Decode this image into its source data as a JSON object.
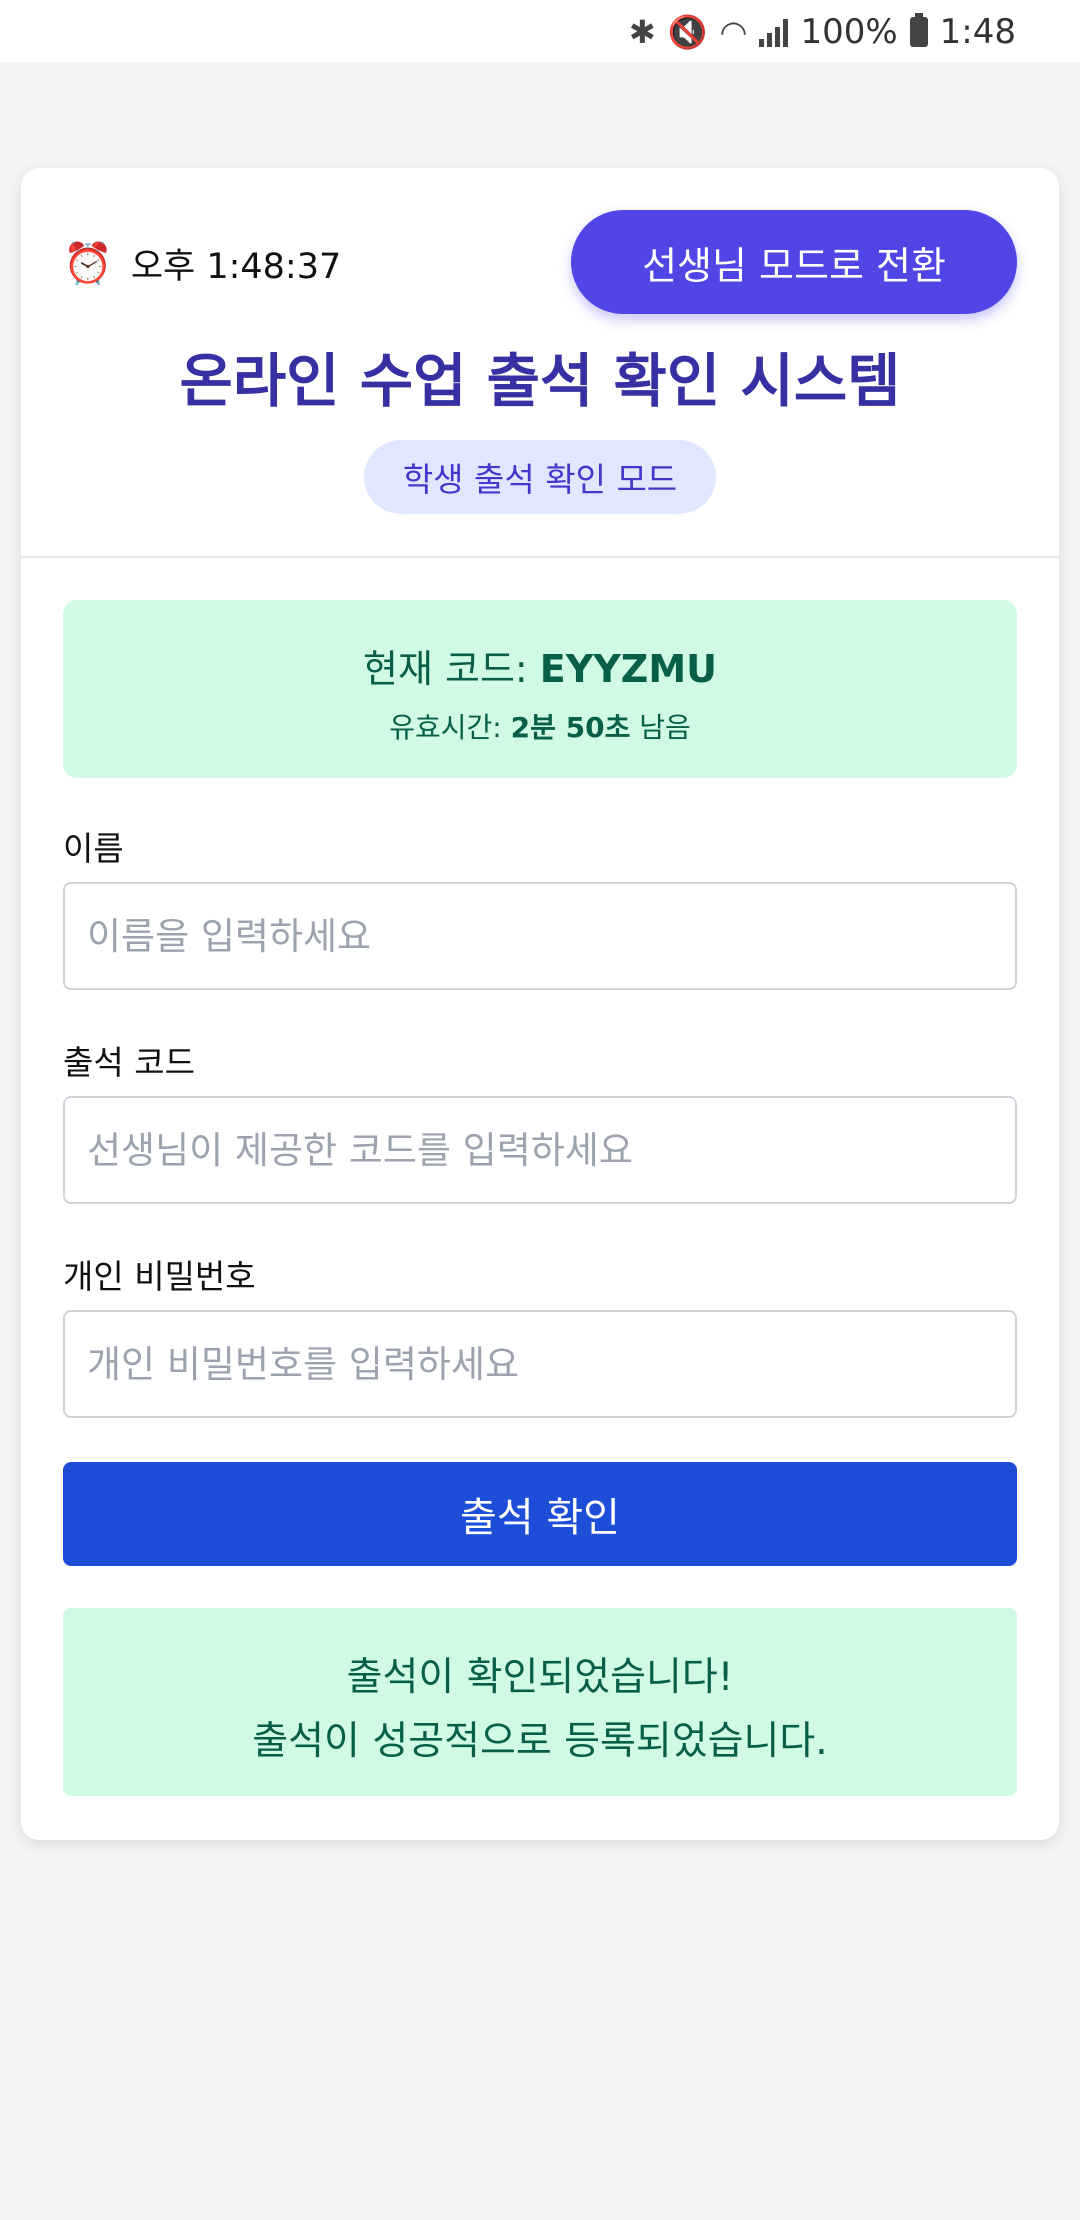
{
  "status_bar": {
    "battery": "100%",
    "time": "1:48"
  },
  "header": {
    "clock_icon": "alarm-clock-icon",
    "clock_time": "오후 1:48:37",
    "mode_switch_label": "선생님 모드로 전환",
    "title": "온라인 수업 출석 확인 시스템",
    "mode_badge": "학생 출석 확인 모드"
  },
  "code_box": {
    "code_prefix": "현재 코드: ",
    "code": "EYYZMU",
    "validity_prefix": "유효시간: ",
    "validity_value": "2분 50초",
    "validity_suffix": " 남음"
  },
  "form": {
    "name_label": "이름",
    "name_placeholder": "이름을 입력하세요",
    "code_label": "출석 코드",
    "code_placeholder": "선생님이 제공한 코드를 입력하세요",
    "password_label": "개인 비밀번호",
    "password_placeholder": "개인 비밀번호를 입력하세요",
    "submit_label": "출석 확인"
  },
  "result": {
    "line1": "출석이 확인되었습니다!",
    "line2": "출석이 성공적으로 등록되었습니다."
  },
  "colors": {
    "accent": "#4f46e5",
    "primary_button": "#1d4ed8",
    "title": "#3730a3",
    "success_bg": "#d1fae5",
    "success_text": "#065f46"
  }
}
